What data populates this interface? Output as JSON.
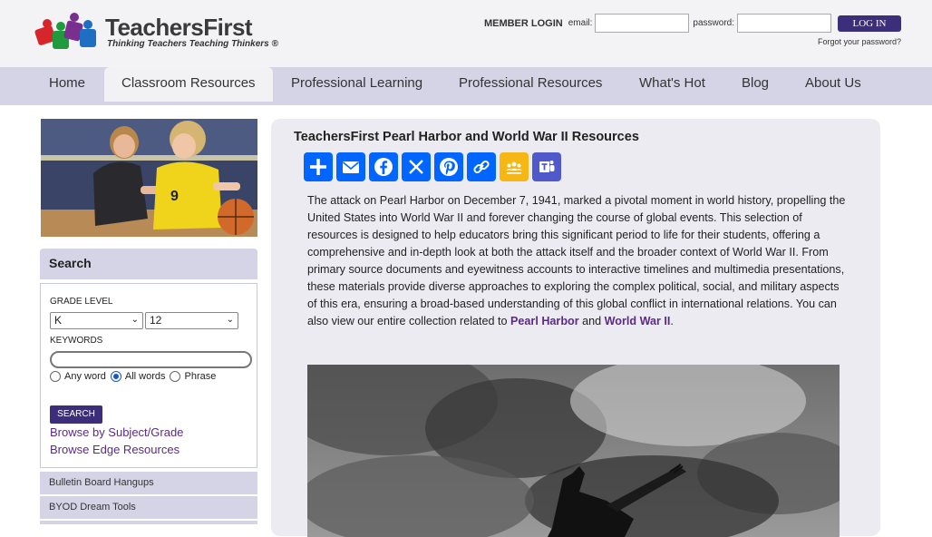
{
  "header": {
    "logo_title": "TeachersFirst",
    "logo_tagline": "Thinking Teachers Teaching Thinkers ®",
    "member_login": "MEMBER LOGIN",
    "email_label": "email:",
    "email_value": "",
    "password_label": "password:",
    "password_value": "",
    "login_button": "LOG IN",
    "forgot_password": "Forgot your password?"
  },
  "nav": {
    "items": [
      {
        "label": "Home"
      },
      {
        "label": "Classroom Resources"
      },
      {
        "label": "Professional Learning"
      },
      {
        "label": "Professional Resources"
      },
      {
        "label": "What's Hot"
      },
      {
        "label": "Blog"
      },
      {
        "label": "About Us"
      }
    ],
    "active_index": 1
  },
  "sidebar": {
    "search_title": "Search",
    "grade_level_label": "GRADE LEVEL",
    "grade_from": "K",
    "grade_to": "12",
    "keywords_label": "KEYWORDS",
    "keywords_value": "",
    "radio_options": [
      "Any word",
      "All words",
      "Phrase"
    ],
    "radio_selected": "All words",
    "search_button": "SEARCH",
    "links": [
      "Browse by Subject/Grade",
      "Browse Edge Resources"
    ],
    "menu_items": [
      "Bulletin Board Hangups",
      "BYOD Dream Tools"
    ]
  },
  "main": {
    "title": "TeachersFirst Pearl Harbor and World War II Resources",
    "share_icons": [
      "share-icon",
      "email-icon",
      "facebook-icon",
      "x-icon",
      "pinterest-icon",
      "copy-link-icon",
      "google-classroom-icon",
      "teams-icon"
    ],
    "paragraph": "The attack on Pearl Harbor on December 7, 1941, marked a pivotal moment in world history, propelling the United States into World War II and forever changing the course of global events. This selection of resources is designed to help educators bring this significant period to life for their students, offering a comprehensive and in-depth look at both the attack itself and the broader context of World War II. From primary source documents and eyewitness accounts to interactive timelines and multimedia presentations, these materials provide diverse approaches to exploring the complex political, social, and military aspects of this era, ensuring a broad-based understanding of this global conflict in international relations. You can also view our entire collection related to",
    "link_pearl_harbor": "Pearl Harbor",
    "conjunction": "and",
    "link_ww2": "World War II",
    "end_punct": "."
  },
  "colors": {
    "header_bg": "#f3f3f6",
    "nav_bg": "#d5d4e6",
    "accent_purple": "#3d2e7c",
    "link_purple": "#5b2a88",
    "share_blue": "#0166ff",
    "content_bg": "#ecebf2"
  }
}
